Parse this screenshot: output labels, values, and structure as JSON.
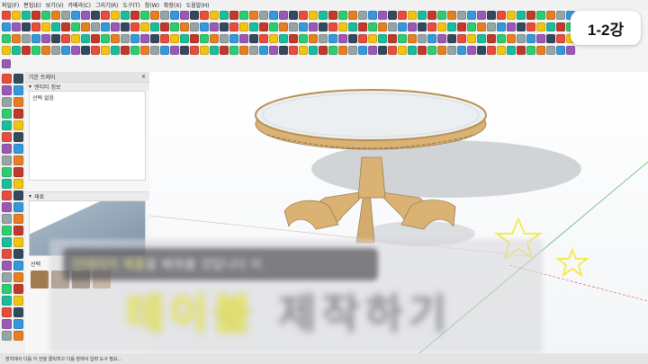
{
  "menu": [
    "파일(F)",
    "편집(E)",
    "보기(V)",
    "카메라(C)",
    "그리기(R)",
    "도구(T)",
    "창(W)",
    "확장(X)",
    "도움말(H)"
  ],
  "tray": {
    "title": "기본 트레이",
    "entity_info": "엔티티 정보",
    "selection": "선택 없음",
    "styles": "재료",
    "select_label": "선택"
  },
  "status": "장치에서 다음 이 안을 클릭하고 다음 장에서 입력 도구 필요...",
  "badge": "1-2강",
  "caption": {
    "line1_highlight": "인테리어 제품",
    "line1_rest": "을 배워볼 것입니다 이",
    "line2_highlight": "테이블",
    "line2_rest": "제작하기"
  },
  "colors": {
    "accent": "#f2f06a",
    "table_wood": "#d9b274",
    "marble": "#eceff1"
  }
}
